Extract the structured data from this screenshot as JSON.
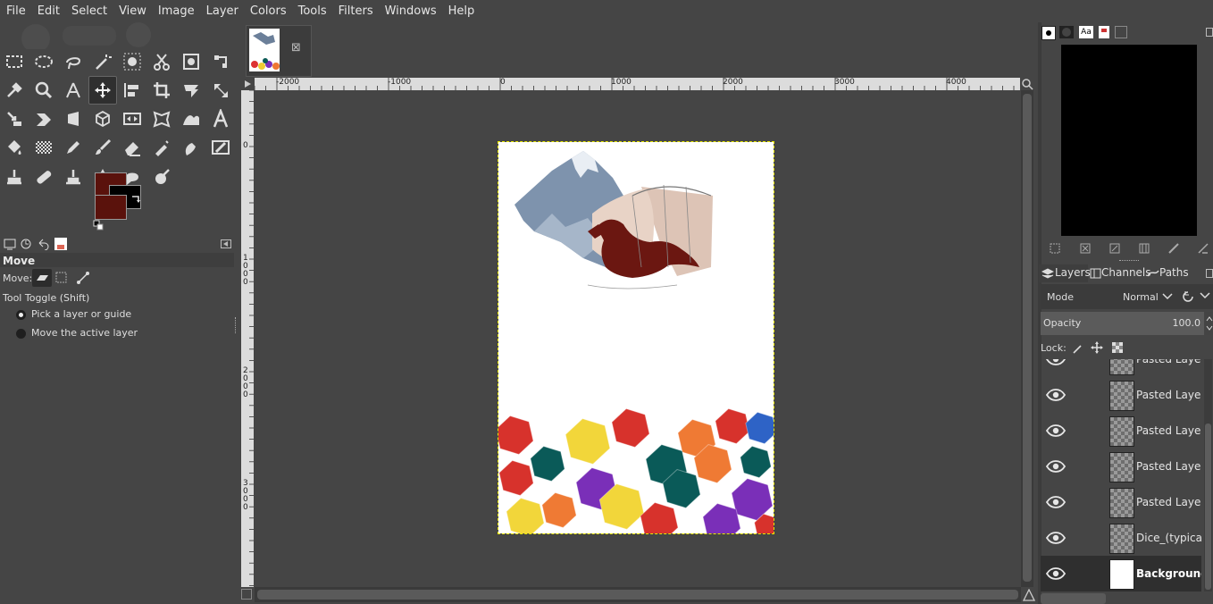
{
  "menu": [
    "File",
    "Edit",
    "Select",
    "View",
    "Image",
    "Layer",
    "Colors",
    "Tools",
    "Filters",
    "Windows",
    "Help"
  ],
  "tool_options": {
    "title": "Move",
    "move_label": "Move:",
    "toggle_label": "Tool Toggle  (Shift)",
    "options": [
      "Pick a layer or guide",
      "Move the active layer"
    ],
    "selected_option": 0
  },
  "colors": {
    "foreground": "#5a120c",
    "background": "#000000"
  },
  "rulers": {
    "horizontal": [
      "-2000",
      "-1000",
      "0",
      "1000",
      "2000",
      "3000",
      "4000"
    ],
    "vertical": [
      "0",
      "1000",
      "2000",
      "3000"
    ]
  },
  "image_tab": {
    "close_glyph": "⊠"
  },
  "dock_tabs": {
    "layers": "Layers",
    "channels": "Channels",
    "paths": "Paths"
  },
  "layers_panel": {
    "mode_label": "Mode",
    "mode_value": "Normal",
    "opacity_label": "Opacity",
    "opacity_value": "100.0",
    "lock_label": "Lock:"
  },
  "layers": [
    {
      "name": "Pasted Layer #",
      "active": false
    },
    {
      "name": "Pasted Layer #",
      "active": false
    },
    {
      "name": "Pasted Layer #",
      "active": false
    },
    {
      "name": "Pasted Layer #",
      "active": false
    },
    {
      "name": "Pasted Layer",
      "active": false
    },
    {
      "name": "Dice_(typical_rc",
      "active": false
    },
    {
      "name": "Background",
      "active": true
    }
  ]
}
